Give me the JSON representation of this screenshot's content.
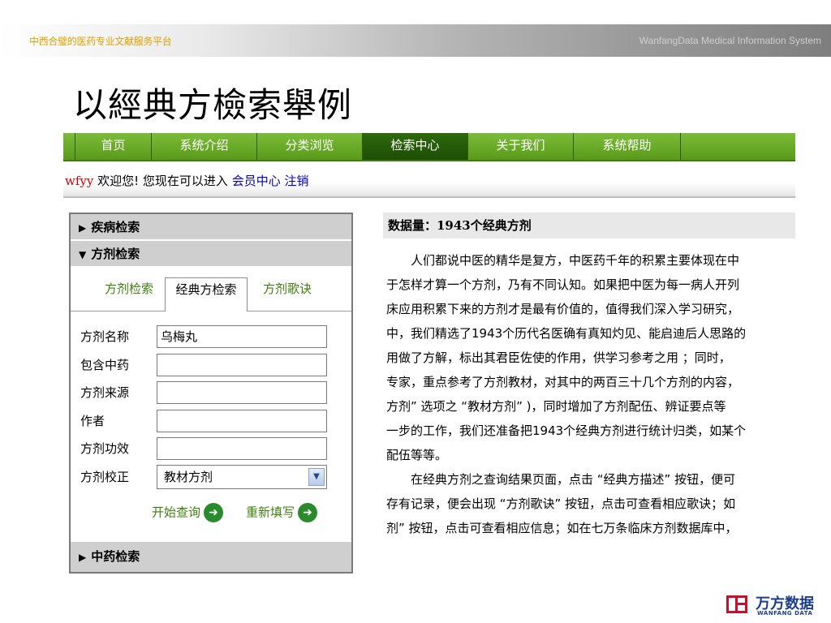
{
  "banner": {
    "left_text": "中西合璧的医药专业文献服务平台",
    "right_text": "WanfangData Medical Information System"
  },
  "slide_title": "以經典方檢索舉例",
  "nav": {
    "items": [
      {
        "label": "首页"
      },
      {
        "label": "系统介绍"
      },
      {
        "label": "分类浏览"
      },
      {
        "label": "检索中心"
      },
      {
        "label": "关于我们"
      },
      {
        "label": "系统帮助"
      }
    ],
    "active": "检索中心"
  },
  "welcome": {
    "user": "wfyy",
    "greeting": " 欢迎您! ",
    "message": "您现在可以进入",
    "member_link": "会员中心",
    "logout_link": "注销"
  },
  "panel": {
    "disease_search": "疾病检索",
    "formula_search": "方剂检索",
    "herb_search": "中药检索",
    "tabs": [
      {
        "label": "方剂检索"
      },
      {
        "label": "经典方检索"
      },
      {
        "label": "方剂歌诀"
      }
    ],
    "active_tab": "经典方检索",
    "fields": [
      {
        "label": "方剂名称",
        "value": "乌梅丸"
      },
      {
        "label": "包含中药",
        "value": ""
      },
      {
        "label": "方剂来源",
        "value": ""
      },
      {
        "label": "作者",
        "value": ""
      },
      {
        "label": "方剂功效",
        "value": ""
      }
    ],
    "select": {
      "label": "方剂校正",
      "value": "教材方剂"
    },
    "start_search": "开始查询",
    "reset": "重新填写"
  },
  "content": {
    "header": "数据量：1943个经典方剂",
    "lines": [
      "　　人们都说中医的精华是复方，中医药千年的积累主要体现在中",
      "于怎样才算一个方剂，乃有不同认知。如果把中医为每一病人开列",
      "床应用积累下来的方剂才是最有价值的，值得我们深入学习研究，",
      "中，我们精选了1943个历代名医确有真知灼见、能启迪后人思路的",
      "用做了方解，标出其君臣佐使的作用，供学习参考之用 ；同时，",
      "专家，重点参考了方剂教材，对其中的两百三十几个方剂的内容，",
      "方剂” 选项之 “教材方剂” )，同时增加了方剂配伍、辨证要点等",
      "一步的工作，我们还准备把1943个经典方剂进行统计归类，如某个",
      "配伍等等。",
      "　　在经典方剂之查询结果页面，点击 “经典方描述” 按钮，便可",
      "存有记录，便会出现 “方剂歌诀” 按钮，点击可查看相应歌诀；如",
      "剂” 按钮，点击可查看相应信息；如在七万条临床方剂数据库中，"
    ]
  },
  "logo": {
    "cn": "万方数据",
    "en": "WANFANG DATA"
  },
  "colors": {
    "nav_green": "#6aaa28",
    "nav_active": "#2a640a",
    "link_green": "#3f7f10",
    "user_red": "#d00000",
    "link_blue": "#0000cc",
    "banner_gold": "#e0a100"
  }
}
